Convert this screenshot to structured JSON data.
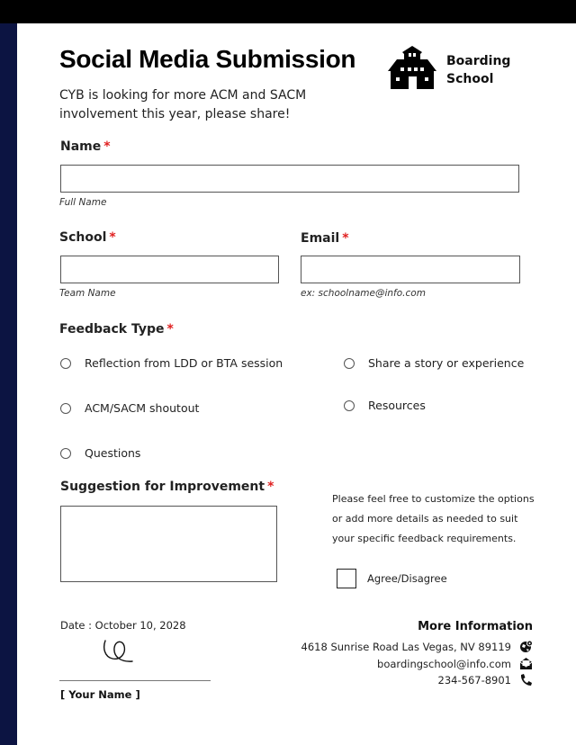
{
  "header": {
    "title": "Social Media Submission",
    "subtitle": "CYB is looking for more ACM and SACM involvement this year, please share!",
    "brand_line1": "Boarding",
    "brand_line2": "School",
    "logo_icon": "school-building-icon"
  },
  "form": {
    "required_mark": "*",
    "name": {
      "label": "Name",
      "value": "",
      "hint": "Full Name"
    },
    "school": {
      "label": "School",
      "value": "",
      "hint": "Team Name"
    },
    "email": {
      "label": "Email",
      "value": "",
      "hint": "ex: schoolname@info.com"
    },
    "feedback_type": {
      "label": "Feedback Type",
      "options": [
        {
          "label": "Reflection from LDD or BTA session",
          "selected": false
        },
        {
          "label": "ACM/SACM shoutout",
          "selected": false
        },
        {
          "label": "Questions",
          "selected": false
        },
        {
          "label": "Share a story or experience",
          "selected": false
        },
        {
          "label": "Resources",
          "selected": false
        }
      ]
    },
    "suggestion": {
      "label": "Suggestion for Improvement",
      "value": ""
    },
    "note_lines": [
      "Please feel free to customize the options",
      "or add more details as needed to suit",
      "your specific feedback requirements."
    ],
    "agree": {
      "label": "Agree/Disagree",
      "checked": false
    }
  },
  "footer": {
    "date": "Date : October 10, 2028",
    "signature_name": "[ Your Name ]",
    "more_info_title": "More Information",
    "address": "4618 Sunrise Road Las Vegas, NV 89119",
    "email": "boardingschool@info.com",
    "phone": "234-567-8901"
  },
  "colors": {
    "sidebar": "#0c1442",
    "topbar": "#000000",
    "required": "#e02020"
  }
}
